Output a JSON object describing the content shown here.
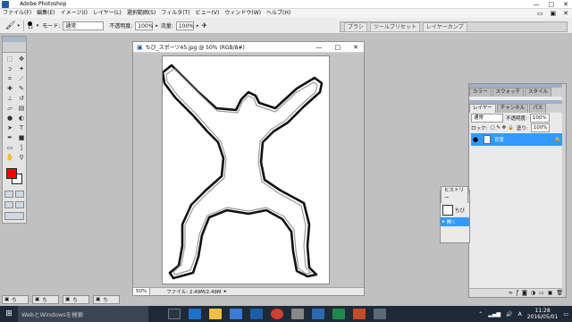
{
  "app": {
    "title": "Adobe Photoshop",
    "window_controls": [
      "—",
      "□",
      "✕"
    ],
    "menu_controls": [
      "▭",
      "▣",
      "✕"
    ]
  },
  "menubar": {
    "items": [
      "ファイル(F)",
      "編集(E)",
      "イメージ(I)",
      "レイヤー(L)",
      "選択範囲(S)",
      "フィルタ(T)",
      "ビュー(V)",
      "ウィンドウ(W)",
      "ヘルプ(H)"
    ]
  },
  "options": {
    "brush_size": "13",
    "mode_label": "モード:",
    "mode_value": "通常",
    "opacity_label": "不透明度:",
    "opacity_value": "100%",
    "flow_label": "流量:",
    "flow_value": "100%",
    "well_tabs": [
      "ブラシ",
      "ツールプリセット",
      "レイヤーカンプ"
    ]
  },
  "document": {
    "title": "ちび_スポーツ45.jpg @ 50% (RGB/8#)",
    "controls": [
      "—",
      "□",
      "✕"
    ],
    "zoom": "50%",
    "file_info": "ファイル: 2.49M/2.49M"
  },
  "layers_palette": {
    "tabs_top": [
      "カラー",
      "スウォッチ",
      "スタイル"
    ],
    "tabs": [
      "レイヤー",
      "チャンネル",
      "パス"
    ],
    "blend_mode": "通常",
    "opacity_label": "不透明度:",
    "opacity_value": "100%",
    "lock_label": "ロック:",
    "fill_label": "塗り:",
    "fill_value": "100%",
    "layer_name": "背景"
  },
  "history_palette": {
    "title": "ヒストリー",
    "items": [
      "ちび",
      "開く"
    ]
  },
  "minimized": [
    {
      "label": "ち"
    },
    {
      "label": "ち"
    },
    {
      "label": "ち"
    },
    {
      "label": "ち"
    }
  ],
  "taskbar": {
    "search_placeholder": "WebとWindowsを検索",
    "time": "11:28",
    "date": "2016/05/01",
    "ime": "A"
  },
  "colors": {
    "foreground": "#ff0000",
    "background": "#ffffff",
    "selection": "#3399ff"
  }
}
